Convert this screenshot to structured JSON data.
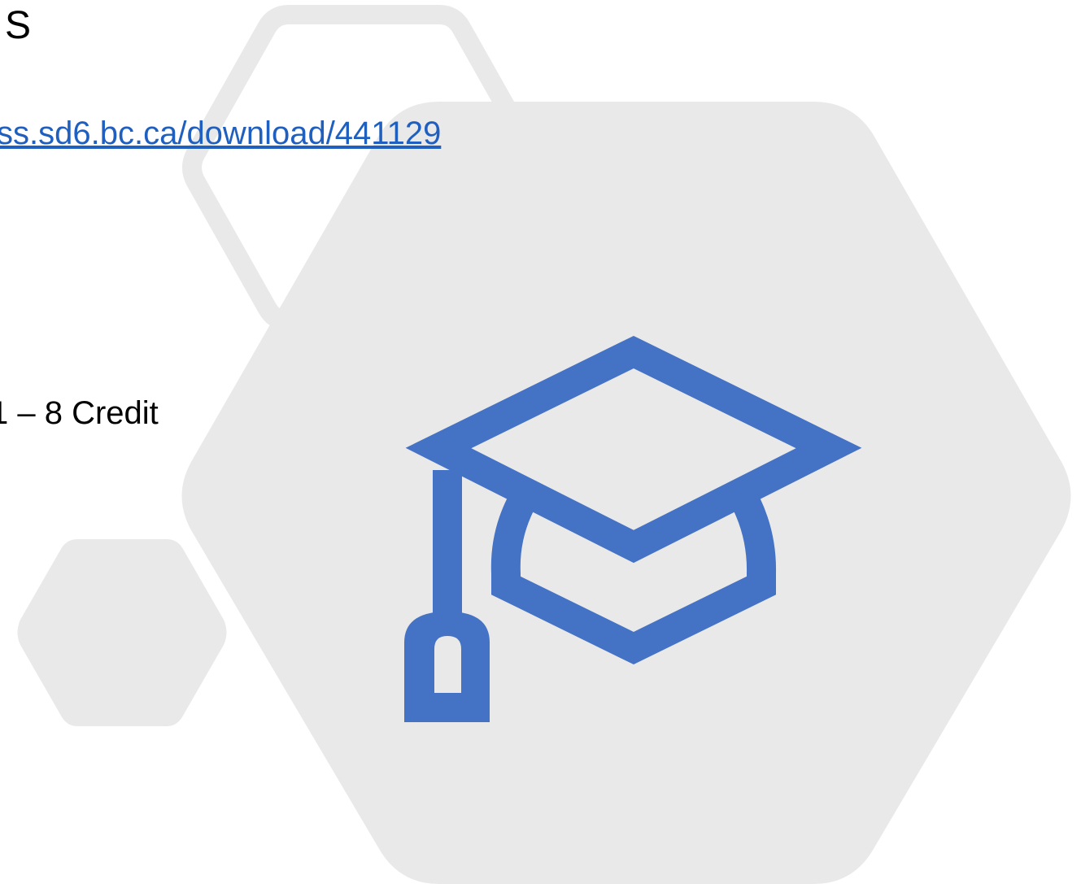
{
  "slide": {
    "title_fragment": "S",
    "link_fragment": "ss.sd6.bc.ca/download/441129",
    "credit_fragment": "1 – 8 Credit"
  },
  "colors": {
    "hex_fill": "#e9e9ea",
    "hex_outline": "#e9e9ea",
    "icon": "#4472c4",
    "link": "#1f5fbf"
  },
  "icons": {
    "main": "graduation-cap-icon"
  }
}
